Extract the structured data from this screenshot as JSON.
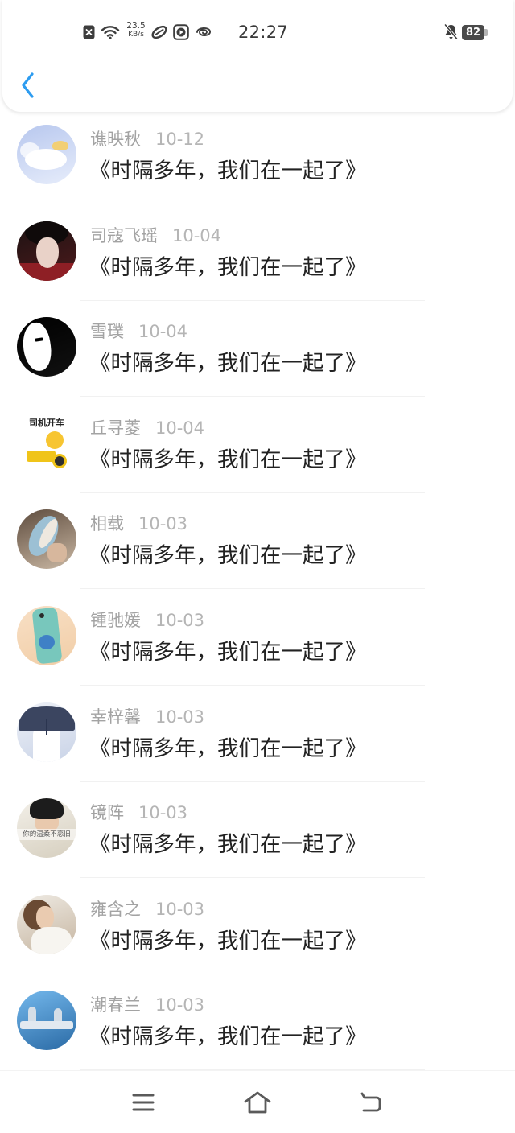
{
  "status_bar": {
    "left_icons": [
      "close-box-icon",
      "wifi-icon",
      "loop-icon",
      "play-icon",
      "spiral-icon"
    ],
    "network_speed": {
      "value": "23.5",
      "unit": "KB/s"
    },
    "time": "22:27",
    "right_icons": [
      "bell-off-icon",
      "battery-icon"
    ],
    "battery_level": "82"
  },
  "header": {
    "back_icon": "chevron-left-icon",
    "accent_color": "#2d9cf0"
  },
  "colors": {
    "name_text": "#a3a3a3",
    "date_text": "#b5b5b5",
    "title_text": "#222222",
    "background": "#ffffff"
  },
  "list": {
    "items": [
      {
        "name": "谯映秋",
        "date": "10-12",
        "title": "《时隔多年，我们在一起了》",
        "avatar": {
          "colors": [
            "#b7c7ee",
            "#e7edfb"
          ],
          "accent": "#ffffff"
        }
      },
      {
        "name": "司寇飞瑶",
        "date": "10-04",
        "title": "《时隔多年，我们在一起了》",
        "avatar": {
          "colors": [
            "#1b1212",
            "#4e1a1c"
          ],
          "accent": "#e9d2c8"
        }
      },
      {
        "name": "雪璞",
        "date": "10-04",
        "title": "《时隔多年，我们在一起了》",
        "avatar": {
          "colors": [
            "#000000",
            "#111111"
          ],
          "accent": "#ffffff"
        }
      },
      {
        "name": "丘寻菱",
        "date": "10-04",
        "title": "《时隔多年，我们在一起了》",
        "avatar": {
          "colors": [
            "#ffffff",
            "#ffffff"
          ],
          "accent": "#f0c419",
          "caption": "司机开车"
        }
      },
      {
        "name": "相载",
        "date": "10-03",
        "title": "《时隔多年，我们在一起了》",
        "avatar": {
          "colors": [
            "#5e4c3e",
            "#c9b7a3"
          ],
          "accent": "#9cc0d4"
        }
      },
      {
        "name": "锺驰媛",
        "date": "10-03",
        "title": "《时隔多年，我们在一起了》",
        "avatar": {
          "colors": [
            "#f8e0c6",
            "#f1cda6"
          ],
          "accent": "#78c7bc"
        }
      },
      {
        "name": "幸梓馨",
        "date": "10-03",
        "title": "《时隔多年，我们在一起了》",
        "avatar": {
          "colors": [
            "#eef1f7",
            "#c9d3e7"
          ],
          "accent": "#3b4560"
        }
      },
      {
        "name": "镜阵",
        "date": "10-03",
        "title": "《时隔多年，我们在一起了》",
        "avatar": {
          "colors": [
            "#f3f0e9",
            "#d6cfbf"
          ],
          "accent": "#1c1c1c",
          "caption": "你的温柔不恋旧"
        }
      },
      {
        "name": "雍含之",
        "date": "10-03",
        "title": "《时隔多年，我们在一起了》",
        "avatar": {
          "colors": [
            "#efebe4",
            "#c5b49f"
          ],
          "accent": "#f7f5f0"
        }
      },
      {
        "name": "潮春兰",
        "date": "10-03",
        "title": "《时隔多年，我们在一起了》",
        "avatar": {
          "colors": [
            "#74b8ec",
            "#2a6aa5"
          ],
          "accent": "#e2e9f0"
        }
      }
    ]
  },
  "nav_bar": {
    "buttons": [
      {
        "icon": "menu-icon"
      },
      {
        "icon": "home-icon"
      },
      {
        "icon": "back-icon"
      }
    ]
  }
}
